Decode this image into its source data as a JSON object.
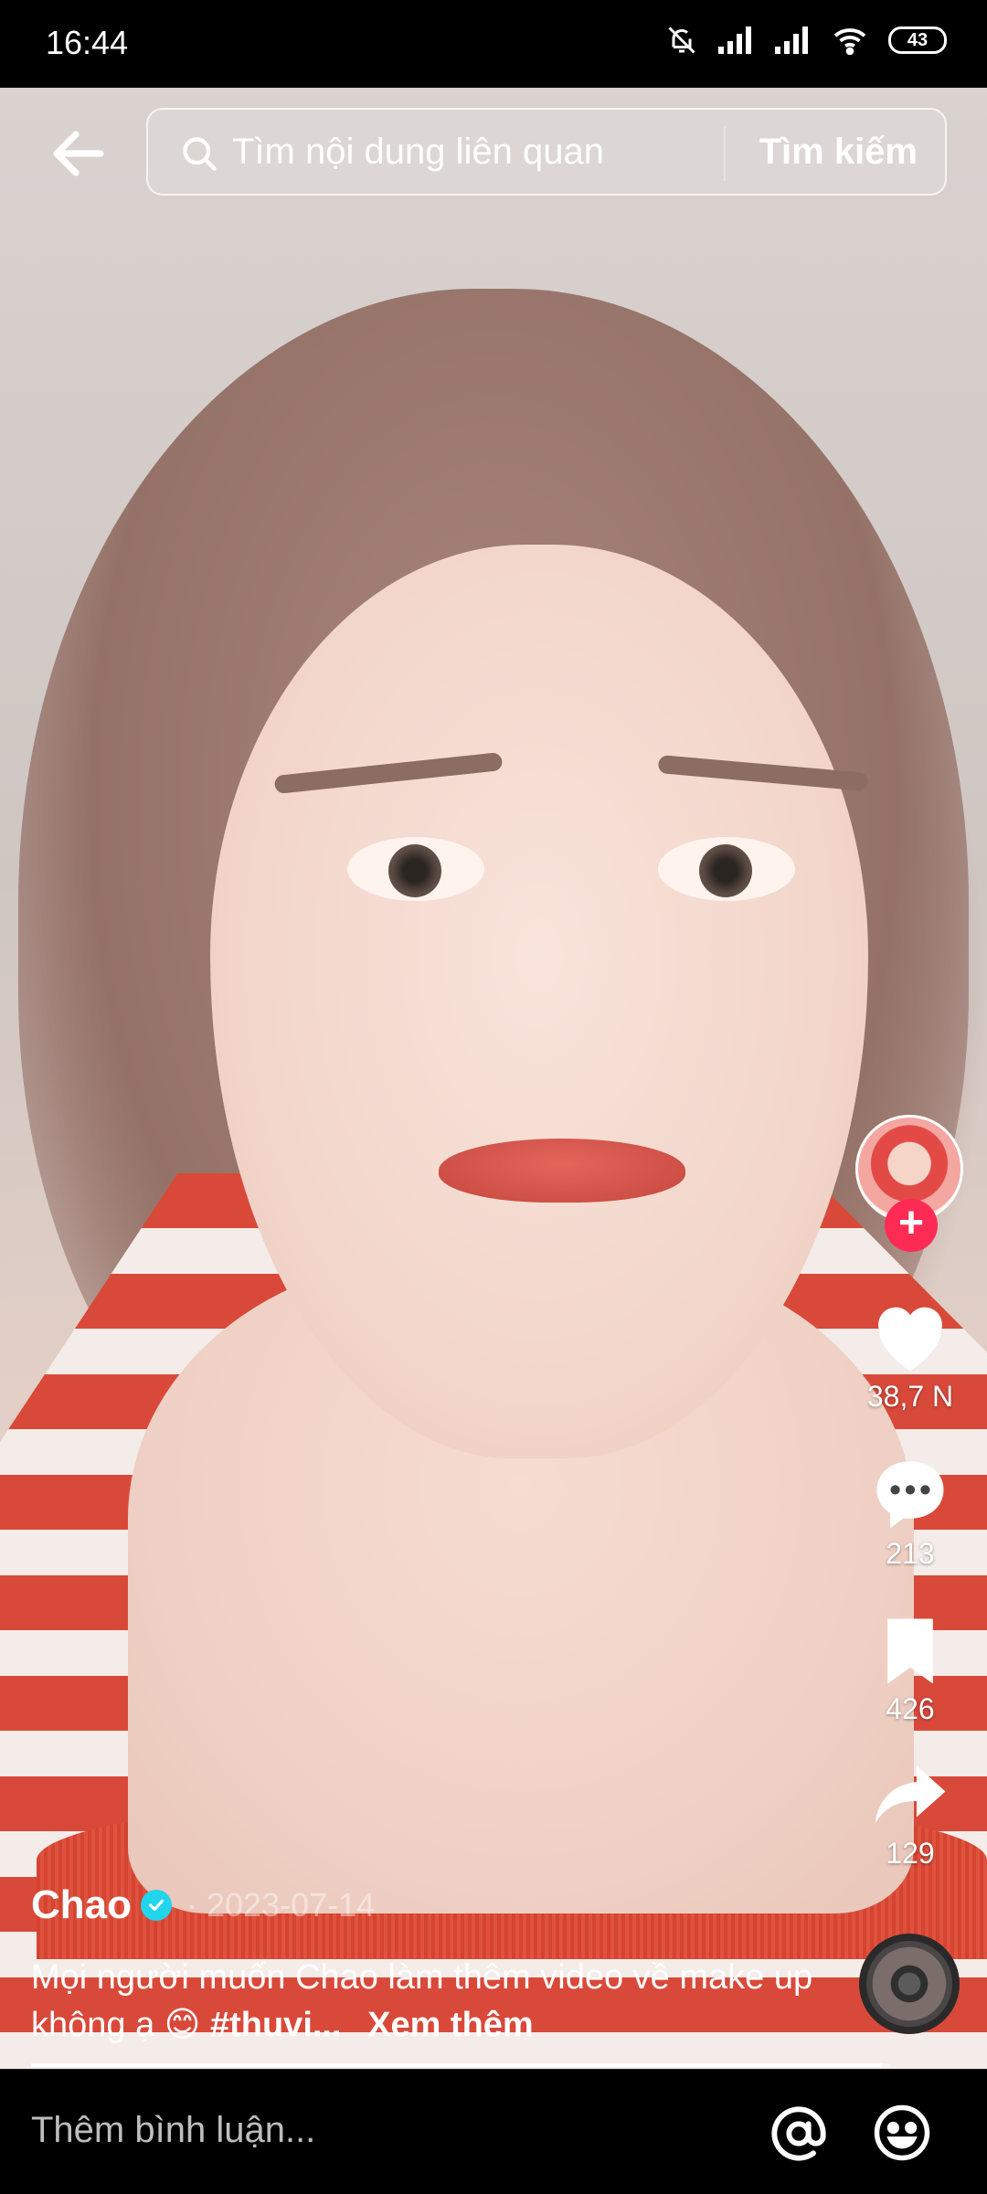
{
  "status_bar": {
    "time": "16:44",
    "battery": "43"
  },
  "search": {
    "placeholder": "Tìm nội dung liên quan",
    "button_label": "Tìm kiếm"
  },
  "actions": {
    "likes": "38,7 N",
    "comments": "213",
    "saves": "426",
    "shares": "129"
  },
  "post": {
    "author": "Chao",
    "date": "2023-07-14",
    "caption_text": "Mọi người muốn Chao làm thêm video về make up không ạ 😊",
    "hashtag": "#thuvi...",
    "see_more": "Xem thêm",
    "progress": 0.99
  },
  "comment_bar": {
    "placeholder": "Thêm bình luận..."
  },
  "icons": {
    "back": "arrow-left-icon",
    "search": "search-icon",
    "like": "heart-icon",
    "comment": "comment-bubble-icon",
    "save": "bookmark-icon",
    "share": "share-arrow-icon",
    "mention": "at-sign-icon",
    "emoji": "emoji-icon"
  },
  "colors": {
    "follow": "#fe2c55",
    "verified": "#20d5ec"
  }
}
